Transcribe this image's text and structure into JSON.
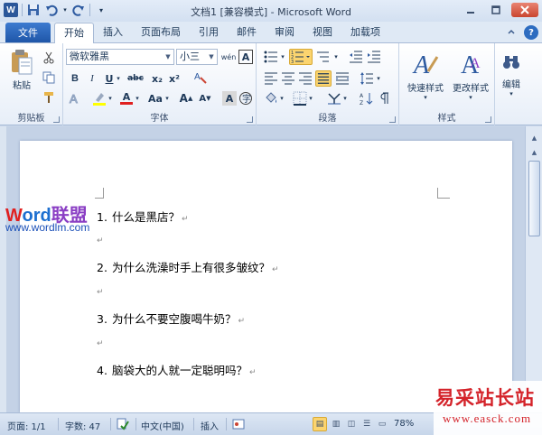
{
  "title": "文档1 [兼容模式] - Microsoft Word",
  "qat": {
    "app_icon": "W"
  },
  "tabs": {
    "file": "文件",
    "items": [
      "开始",
      "插入",
      "页面布局",
      "引用",
      "邮件",
      "审阅",
      "视图",
      "加载项"
    ]
  },
  "ribbon": {
    "clipboard": {
      "label": "剪贴板",
      "paste": "粘贴"
    },
    "font": {
      "label": "字体",
      "font_name": "微软雅黑",
      "font_size": "小三",
      "bold": "B",
      "italic": "I",
      "underline": "U",
      "strike": "abc",
      "subscript": "x₂",
      "superscript": "x²",
      "font_color_letter": "A",
      "change_case": "Aa",
      "grow": "A",
      "shrink": "A",
      "phonetic": "wén",
      "char_border": "A",
      "char_shade": "A"
    },
    "paragraph": {
      "label": "段落"
    },
    "styles": {
      "label": "样式",
      "quick_styles": "快速样式",
      "change_styles": "更改样式"
    },
    "editing": {
      "label": "编辑"
    }
  },
  "document": {
    "items": [
      {
        "num": "1.",
        "text": "什么是黑店？"
      },
      {
        "num": "2.",
        "text": "为什么洗澡时手上有很多皱纹？"
      },
      {
        "num": "3.",
        "text": "为什么不要空腹喝牛奶？"
      },
      {
        "num": "4.",
        "text": "脑袋大的人就一定聪明吗？"
      }
    ],
    "para_mark": "↵"
  },
  "watermarks": {
    "brand_a": "W",
    "brand_b": "ord",
    "brand_c": "联盟",
    "url": "www.wordlm.com",
    "bottom_cn": "易采站长站",
    "bottom_url": "www.easck.com"
  },
  "status": {
    "page": "页面: 1/1",
    "words": "字数: 47",
    "language": "中文(中国)",
    "insert_mode": "插入",
    "zoom": "78%",
    "zoom_percent": 78
  }
}
